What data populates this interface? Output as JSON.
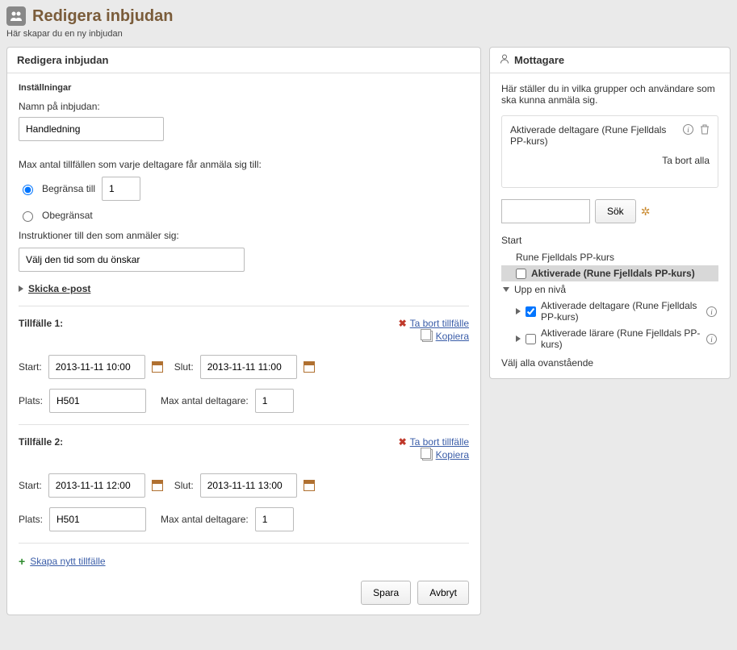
{
  "header": {
    "title": "Redigera inbjudan",
    "subtitle": "Här skapar du en ny inbjudan"
  },
  "left": {
    "panel_title": "Redigera inbjudan",
    "settings_label": "Inställningar",
    "name_label": "Namn på inbjudan:",
    "name_value": "Handledning",
    "max_label": "Max antal tillfällen som varje deltagare får anmäla sig till:",
    "limit_label": "Begränsa till",
    "limit_value": "1",
    "unlimited_label": "Obegränsat",
    "instructions_label": "Instruktioner till den som anmäler sig:",
    "instructions_value": "Välj den tid som du önskar",
    "email_toggle": "Skicka e-post",
    "remove_label": "Ta bort tillfälle",
    "copy_label": "Kopiera",
    "start_label": "Start:",
    "end_label": "Slut:",
    "location_label": "Plats:",
    "max_participants_label": "Max antal deltagare:",
    "occasions": [
      {
        "title": "Tillfälle 1:",
        "start": "2013-11-11 10:00",
        "end": "2013-11-11 11:00",
        "location": "H501",
        "max": "1"
      },
      {
        "title": "Tillfälle 2:",
        "start": "2013-11-11 12:00",
        "end": "2013-11-11 13:00",
        "location": "H501",
        "max": "1"
      }
    ],
    "create_label": "Skapa nytt tillfälle",
    "save_label": "Spara",
    "cancel_label": "Avbryt"
  },
  "right": {
    "panel_title": "Mottagare",
    "description": "Här ställer du in vilka grupper och användare som ska kunna anmäla sig.",
    "selected_item": "Aktiverade deltagare (Rune Fjelldals PP-kurs)",
    "remove_all": "Ta bort alla",
    "search_label": "Sök",
    "tree_root": "Start",
    "tree_course": "Rune Fjelldals PP-kurs",
    "tree_active": "Aktiverade (Rune Fjelldals PP-kurs)",
    "up_label": "Upp en nivå",
    "tree_participants": "Aktiverade deltagare (Rune Fjelldals PP-kurs)",
    "tree_teachers": "Aktiverade lärare (Rune Fjelldals PP-kurs)",
    "select_all": "Välj alla ovanstående"
  }
}
